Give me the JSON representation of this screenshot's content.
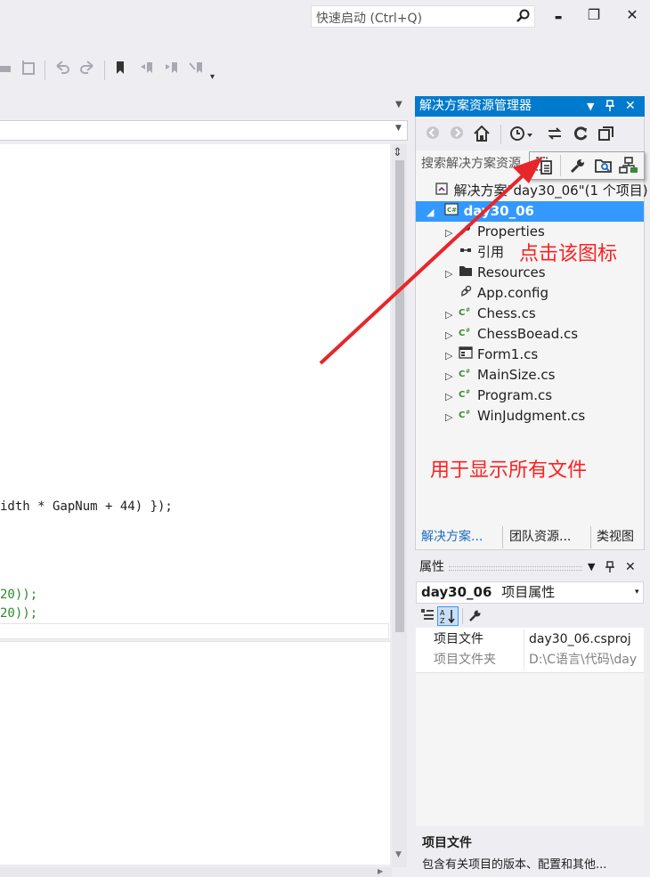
{
  "titlebar": {
    "quick_launch_placeholder": "快速启动 (Ctrl+Q)",
    "min": "▬",
    "restore": "❐",
    "close": "✕"
  },
  "editor": {
    "code_lines": [
      {
        "text": "idth * GapNum + 44) });",
        "color": "#1e1e1e"
      },
      {
        "text": "20));",
        "color": "#2b8a2b"
      },
      {
        "text": "20));",
        "color": "#2b8a2b"
      }
    ]
  },
  "solution_explorer": {
    "title": "解决方案资源管理器",
    "title_buttons": [
      "▾",
      "📌",
      "✕"
    ],
    "search_placeholder": "搜索解决方案资源",
    "solution_label": "解决方案\"day30_06\"(1 个项目)",
    "project_label": "day30_06",
    "items": [
      {
        "label": "Properties",
        "icon": "wrench-icon",
        "expandable": true
      },
      {
        "label": "引用",
        "icon": "reference-icon",
        "expandable": false
      },
      {
        "label": "Resources",
        "icon": "folder-icon",
        "expandable": true
      },
      {
        "label": "App.config",
        "icon": "config-icon",
        "expandable": false
      },
      {
        "label": "Chess.cs",
        "icon": "csharp-file-icon",
        "expandable": true
      },
      {
        "label": "ChessBoead.cs",
        "icon": "csharp-file-icon",
        "expandable": true
      },
      {
        "label": "Form1.cs",
        "icon": "form-icon",
        "expandable": true
      },
      {
        "label": "MainSize.cs",
        "icon": "csharp-file-icon",
        "expandable": true
      },
      {
        "label": "Program.cs",
        "icon": "csharp-file-icon",
        "expandable": true
      },
      {
        "label": "WinJudgment.cs",
        "icon": "csharp-file-icon",
        "expandable": true
      }
    ],
    "bottom_tabs": [
      "解决方案...",
      "团队资源...",
      "类视图"
    ]
  },
  "properties": {
    "title": "属性",
    "object": "day30_06",
    "object_type": "项目属性",
    "rows": [
      {
        "name": "项目文件",
        "value": "day30_06.csproj"
      },
      {
        "name": "项目文件夹",
        "value": "D:\\C语言\\代码\\day"
      }
    ],
    "desc_title": "项目文件",
    "desc_text": "包含有关项目的版本、配置和其他..."
  },
  "annotations": {
    "click_icon": "点击该图标",
    "show_all_files": "用于显示所有文件",
    "arrow_color": "#e8262a"
  }
}
